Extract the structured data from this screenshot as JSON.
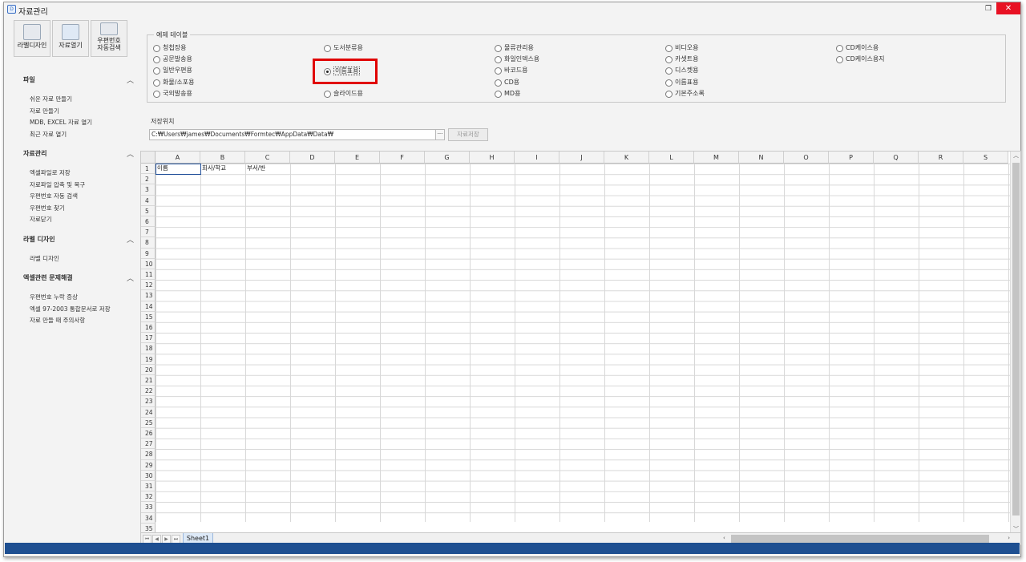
{
  "window": {
    "title": "자료관리",
    "restore_icon": "restore-icon",
    "close_icon": "close-icon",
    "app_icon_text": "D"
  },
  "toolbar": {
    "buttons": [
      "라벨디자인",
      "자료열기",
      "우편번호\n자동검색"
    ]
  },
  "sidebar": {
    "groups": [
      {
        "title": "파일",
        "items": [
          "쉬운 자료 만들기",
          "자료 만들기",
          "MDB, EXCEL 자료 열기",
          "최근 자료 열기"
        ]
      },
      {
        "title": "자료관리",
        "items": [
          "엑셀파일로 저장",
          "자료파일 압축 및 복구",
          "우편번호 자동 검색",
          "우편번호 찾기",
          "자료닫기"
        ]
      },
      {
        "title": "라벨 디자인",
        "items": [
          "라벨 디자인"
        ]
      },
      {
        "title": "엑셀관련 문제해결",
        "items": [
          "우편번호 누락 증상",
          "엑셀 97-2003 통합문서로 저장",
          "자료 만들 때 주의사항"
        ]
      }
    ]
  },
  "examples": {
    "legend": "예제 테이블",
    "selected": "이름표용",
    "columns": [
      [
        "청첩장용",
        "공문발송용",
        "일반우편용",
        "화물/소포용",
        "국외발송용"
      ],
      [
        "도서분류용",
        "",
        "이름표용",
        "",
        "슬라이드용"
      ],
      [
        "물류관리용",
        "화일인덱스용",
        "바코드용",
        "CD용",
        "MD용"
      ],
      [
        "비디오용",
        "카셋트용",
        "디스켓용",
        "이름표용",
        "기본주소록"
      ],
      [
        "CD케이스용",
        "CD케이스용지"
      ]
    ]
  },
  "save": {
    "label": "저장위치",
    "path": "C:₩Users₩james₩Documents₩Formtec₩AppData₩Data₩",
    "browse": "···",
    "button": "자료저장"
  },
  "sheet": {
    "columns": [
      "A",
      "B",
      "C",
      "D",
      "E",
      "F",
      "G",
      "H",
      "I",
      "J",
      "K",
      "L",
      "M",
      "N",
      "O",
      "P",
      "Q",
      "R",
      "S"
    ],
    "row_count": 35,
    "cells": {
      "A1": "이름",
      "B1": "회사/학교",
      "C1": "부서/반"
    },
    "tab": "Sheet1"
  }
}
